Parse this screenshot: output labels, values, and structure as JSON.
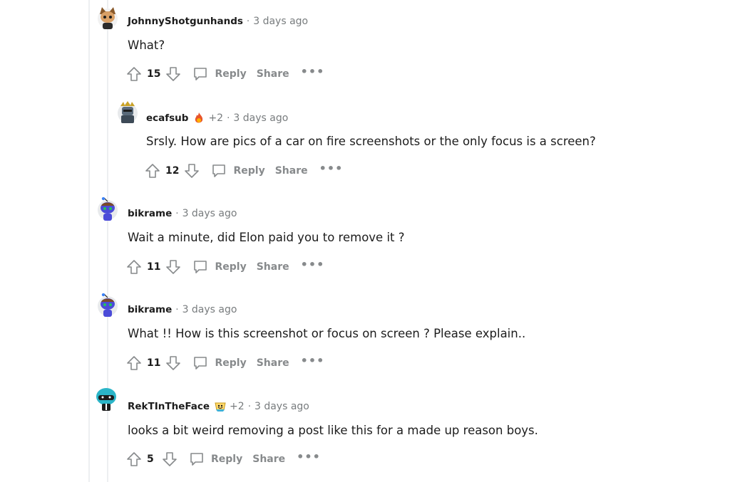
{
  "comments": [
    {
      "author": "JohnnyShotgunhands",
      "plus": "",
      "time": "3 days ago",
      "body": "What?",
      "score": "15",
      "reply": "Reply",
      "share": "Share",
      "more": "•••",
      "avatar": "snoo-hat-avatar"
    },
    {
      "author": "ecafsub",
      "plus": "+2",
      "time": "3 days ago",
      "body": "Srsly. How are pics of a car on fire screenshots or the only focus is a screen?",
      "score": "12",
      "reply": "Reply",
      "share": "Share",
      "more": "•••",
      "avatar": "snoo-armor-avatar",
      "flair": "fire-award-icon"
    },
    {
      "author": "bikrame",
      "plus": "",
      "time": "3 days ago",
      "body": "Wait a minute, did Elon paid you to remove it ?",
      "score": "11",
      "reply": "Reply",
      "share": "Share",
      "more": "•••",
      "avatar": "snoo-blue-avatar"
    },
    {
      "author": "bikrame",
      "plus": "",
      "time": "3 days ago",
      "body": "What !! How is this screenshot or focus on screen ? Please explain..",
      "score": "11",
      "reply": "Reply",
      "share": "Share",
      "more": "•••",
      "avatar": "snoo-blue-avatar"
    },
    {
      "author": "RekTInTheFace",
      "plus": "+2",
      "time": "3 days ago",
      "body": "looks a bit weird removing a post like this for a made up reason boys.",
      "score": "5",
      "reply": "Reply",
      "share": "Share",
      "more": "•••",
      "avatar": "snoo-visor-avatar",
      "flair": "wholesome-award-icon"
    }
  ],
  "separator": "·",
  "colors": {
    "meta": "#787c7e",
    "action": "#878a8c",
    "text": "#1c1c1c",
    "thread": "#edeff1"
  }
}
